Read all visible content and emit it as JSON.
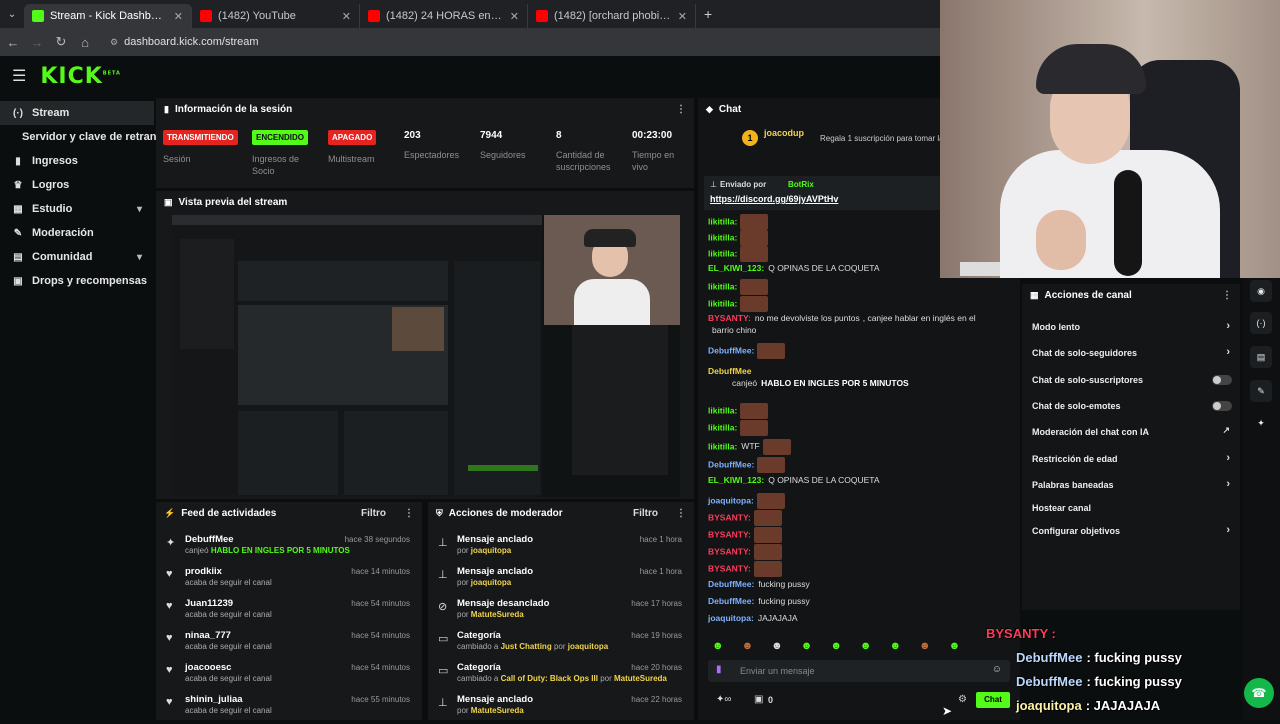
{
  "browser": {
    "tabs": [
      {
        "title": "Stream - Kick Dashboard",
        "color": "#53fc18"
      },
      {
        "title": "(1482) YouTube",
        "color": "#ff0000"
      },
      {
        "title": "(1482) 24 HORAS en STREAM e",
        "color": "#ff0000"
      },
      {
        "title": "(1482) [orchard phobia] - YouTu",
        "color": "#ff0000"
      }
    ],
    "url": "dashboard.kick.com/stream"
  },
  "logo": "KICK",
  "logo_sup": "BETA",
  "sidebar": {
    "items": [
      {
        "label": "Stream",
        "icon": "stream-icon"
      },
      {
        "label": "Servidor y clave de retransm",
        "icon": ""
      },
      {
        "label": "Ingresos",
        "icon": "chart-icon"
      },
      {
        "label": "Logros",
        "icon": "trophy-icon"
      },
      {
        "label": "Estudio",
        "icon": "studio-icon"
      },
      {
        "label": "Moderación",
        "icon": "wrench-icon"
      },
      {
        "label": "Comunidad",
        "icon": "community-icon"
      },
      {
        "label": "Drops y recompensas",
        "icon": "drops-icon"
      }
    ]
  },
  "session": {
    "title": "Información de la sesión",
    "stats": [
      {
        "badge": "TRANSMITIENDO",
        "label": "Sesión",
        "color": "#e5231f"
      },
      {
        "badge": "ENCENDIDO",
        "label": "Ingresos de Socio",
        "color": "#53fc18"
      },
      {
        "badge": "APAGADO",
        "label": "Multistream",
        "color": "#e5231f"
      },
      {
        "value": "203",
        "label": "Espectadores"
      },
      {
        "value": "7944",
        "label": "Seguidores"
      },
      {
        "value": "8",
        "label": "Cantidad de suscripciones"
      },
      {
        "value": "00:23:00",
        "label": "Tiempo en vivo"
      }
    ]
  },
  "preview": {
    "title": "Vista previa del stream"
  },
  "feed": {
    "title": "Feed de actividades",
    "filter": "Filtro",
    "items": [
      {
        "name": "DebuffMee",
        "sub": "canjeó",
        "highlight": "HABLO EN INGLES POR 5 MINUTOS",
        "time": "hace 38 segundos",
        "icon": "reward-icon"
      },
      {
        "name": "prodkiix",
        "sub": "acaba de seguir el canal",
        "time": "hace 14 minutos",
        "icon": "heart-icon"
      },
      {
        "name": "Juan11239",
        "sub": "acaba de seguir el canal",
        "time": "hace 54 minutos",
        "icon": "heart-icon"
      },
      {
        "name": "ninaa_777",
        "sub": "acaba de seguir el canal",
        "time": "hace 54 minutos",
        "icon": "heart-icon"
      },
      {
        "name": "joacooesc",
        "sub": "acaba de seguir el canal",
        "time": "hace 54 minutos",
        "icon": "heart-icon"
      },
      {
        "name": "shinin_juliaa",
        "sub": "acaba de seguir el canal",
        "time": "hace 55 minutos",
        "icon": "heart-icon"
      }
    ]
  },
  "modactions": {
    "title": "Acciones de moderador",
    "filter": "Filtro",
    "items": [
      {
        "action": "Mensaje anclado",
        "pre": "por",
        "who": "joaquitopa",
        "time": "hace 1 hora",
        "icon": "pin-icon"
      },
      {
        "action": "Mensaje anclado",
        "pre": "por",
        "who": "joaquitopa",
        "time": "hace 1 hora",
        "icon": "pin-icon"
      },
      {
        "action": "Mensaje desanclado",
        "pre": "por",
        "who": "MatuteSureda",
        "time": "hace 17 horas",
        "icon": "unpin-icon"
      },
      {
        "action": "Categoría",
        "pre": "cambiado a",
        "what": "Just Chatting",
        "por": "por",
        "who": "joaquitopa",
        "time": "hace 19 horas",
        "icon": "category-icon"
      },
      {
        "action": "Categoría",
        "pre": "cambiado a",
        "what": "Call of Duty: Black Ops III",
        "por": "por",
        "who": "MatuteSureda",
        "time": "hace 20 horas",
        "icon": "category-icon"
      },
      {
        "action": "Mensaje anclado",
        "pre": "por",
        "who": "MatuteSureda",
        "time": "hace 22 horas",
        "icon": "pin-icon"
      }
    ]
  },
  "chat": {
    "title": "Chat",
    "gifter": "joacodup",
    "gift_text": "Regala 1 suscripción para tomar la",
    "pinned_by": "Enviado por",
    "pinned_user": "BotRix",
    "pinned_link": "https://discord.gg/69jyAVPtHv",
    "messages": [
      {
        "user": "likitilla:",
        "text": "",
        "color": "#53fc18",
        "emote": true
      },
      {
        "user": "likitilla:",
        "text": "",
        "color": "#53fc18",
        "emote": true
      },
      {
        "user": "likitilla:",
        "text": "",
        "color": "#53fc18",
        "emote": true
      },
      {
        "user": "EL_KIWI_123:",
        "text": "Q OPINAS DE LA COQUETA",
        "color": "#53fc18"
      },
      {
        "user": "likitilla:",
        "text": "",
        "color": "#53fc18",
        "emote": true
      },
      {
        "user": "likitilla:",
        "text": "",
        "color": "#53fc18",
        "emote": true
      },
      {
        "user": "BYSANTY:",
        "text": "no me devolviste los puntos",
        "text2": ", canjee hablar en inglés en el",
        "color": "#ff3b5c"
      },
      {
        "user": "",
        "text": "barrio chino",
        "color": ""
      },
      {
        "user": "DebuffMee:",
        "text": "",
        "color": "#7fb2ff",
        "emote": true
      },
      {
        "user": "DebuffMee",
        "text": "",
        "color": "#f3d54a"
      },
      {
        "user": "",
        "text": "canjeó",
        "highlight": "HABLO EN INGLES POR 5 MINUTOS",
        "color": ""
      },
      {
        "user": "likitilla:",
        "text": "",
        "color": "#53fc18",
        "emote": true
      },
      {
        "user": "likitilla:",
        "text": "",
        "color": "#53fc18",
        "emote": true
      },
      {
        "user": "likitilla:",
        "text": "WTF",
        "color": "#53fc18",
        "emote": true
      },
      {
        "user": "DebuffMee:",
        "text": "",
        "color": "#7fb2ff",
        "emote": true
      },
      {
        "user": "EL_KIWI_123:",
        "text": "Q OPINAS DE LA COQUETA",
        "color": "#53fc18"
      },
      {
        "user": "joaquitopa:",
        "text": "",
        "color": "#7fb2ff",
        "emote": true
      },
      {
        "user": "BYSANTY:",
        "text": "",
        "color": "#ff3b5c",
        "emote": true
      },
      {
        "user": "BYSANTY:",
        "text": "",
        "color": "#ff3b5c",
        "emote": true
      },
      {
        "user": "BYSANTY:",
        "text": "",
        "color": "#ff3b5c",
        "emote": true
      },
      {
        "user": "BYSANTY:",
        "text": "",
        "color": "#ff3b5c",
        "emote": true
      },
      {
        "user": "DebuffMee:",
        "text": "fucking pussy",
        "color": "#7fb2ff"
      },
      {
        "user": "DebuffMee:",
        "text": "fucking pussy",
        "color": "#7fb2ff"
      },
      {
        "user": "joaquitopa:",
        "text": "JAJAJAJA",
        "color": "#7fb2ff"
      }
    ],
    "input_placeholder": "Enviar un mensaje",
    "points": "0",
    "send_label": "Chat"
  },
  "actions_panel": {
    "title": "Acciones de canal",
    "items": [
      {
        "label": "Modo lento",
        "type": "arrow"
      },
      {
        "label": "Chat de solo-seguidores",
        "type": "arrow"
      },
      {
        "label": "Chat de solo-suscriptores",
        "type": "toggle"
      },
      {
        "label": "Chat de solo-emotes",
        "type": "toggle"
      },
      {
        "label": "Moderación del chat con IA",
        "type": "external"
      },
      {
        "label": "Restricción de edad",
        "type": "arrow"
      },
      {
        "label": "Palabras baneadas",
        "type": "arrow"
      },
      {
        "label": "Hostear canal",
        "type": "none"
      },
      {
        "label": "Configurar objetivos",
        "type": "arrow"
      }
    ]
  },
  "overlay": {
    "lines": [
      {
        "user": "BYSANTY :",
        "text": "",
        "color": "#ff3b5c"
      },
      {
        "user": "DebuffMee",
        "text": ": fucking pussy",
        "color": "#bcd8ff"
      },
      {
        "user": "DebuffMee",
        "text": ": fucking pussy",
        "color": "#bcd8ff"
      },
      {
        "user": "joaquitopa",
        "text": ": JAJAJAJA",
        "color": "#fff1a8"
      }
    ]
  }
}
